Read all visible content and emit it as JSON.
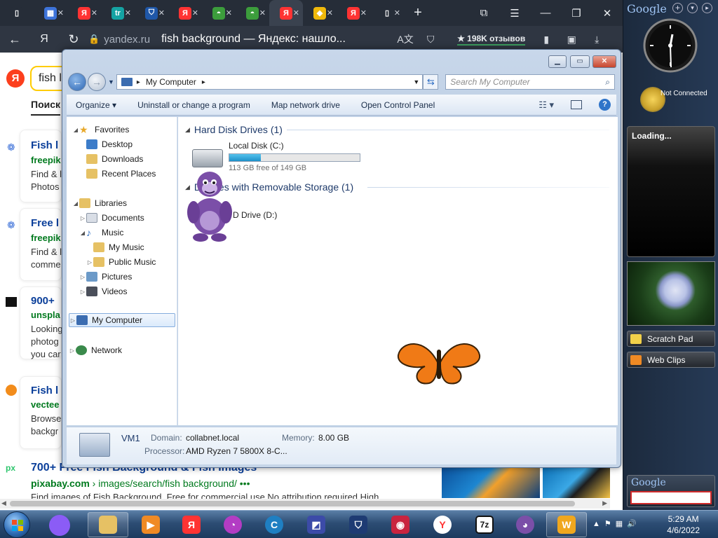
{
  "browser": {
    "tabs": [
      {
        "name": "tab-doc",
        "glyph": "▯",
        "color": "#262d38"
      },
      {
        "name": "tab-apps",
        "glyph": "▦",
        "color": "#3d73d9"
      },
      {
        "name": "tab-yandex-1",
        "glyph": "Я",
        "color": "#f33"
      },
      {
        "name": "tab-tr",
        "glyph": "tr",
        "color": "#15a3a3"
      },
      {
        "name": "tab-shield",
        "glyph": "⛉",
        "color": "#1f57a8"
      },
      {
        "name": "tab-yandex-2",
        "glyph": "Я",
        "color": "#f33"
      },
      {
        "name": "tab-melon-1",
        "glyph": "◓",
        "color": "#3c9d3c"
      },
      {
        "name": "tab-melon-2",
        "glyph": "◓",
        "color": "#3c9d3c"
      },
      {
        "name": "tab-yandex-active",
        "glyph": "Я",
        "color": "#f33"
      },
      {
        "name": "tab-binance",
        "glyph": "◆",
        "color": "#f0b90b"
      },
      {
        "name": "tab-yandex-3",
        "glyph": "Я",
        "color": "#f33"
      },
      {
        "name": "tab-doc-2",
        "glyph": "▯",
        "color": "#262d38"
      }
    ],
    "domain": "yandex.ru",
    "page_title": "fish background — Яндекс: нашло...",
    "reviews": "★ 198K отзывов"
  },
  "yandex": {
    "logo": "Я",
    "query": "fish l",
    "search_tab": "Поиск",
    "results": [
      {
        "title": "Fish l",
        "source": "freepik",
        "snippet": "Find & l\nPhotos"
      },
      {
        "title": "Free l",
        "source": "freepik",
        "snippet": "Find & l\ncomme"
      },
      {
        "title": "900+",
        "source": "unspla",
        "snippet": "Looking\nphotog\nyou car"
      },
      {
        "title": "Fish l",
        "source": "vectee",
        "snippet": "Browse\nbackgr"
      },
      {
        "title": "700+ Free Fish Background & Fish Images",
        "source": "pixabay.com",
        "path": " › images/search/fish background/  •••",
        "snippet": "Find images of Fish Background. Free for commercial use No attribution required High"
      }
    ]
  },
  "explorer": {
    "window_buttons": {
      "minimize": "▁",
      "maximize": "▭",
      "close": "✕"
    },
    "address_root": "▸",
    "address_path": "My Computer",
    "address_arrow": "▸",
    "search_placeholder": "Search My Computer",
    "commands": [
      "Organize ▾",
      "Uninstall or change a program",
      "Map network drive",
      "Open Control Panel"
    ],
    "nav": {
      "favorites": "Favorites",
      "desktop": "Desktop",
      "downloads": "Downloads",
      "recent": "Recent Places",
      "libraries": "Libraries",
      "documents": "Documents",
      "music": "Music",
      "my_music": "My Music",
      "public_music": "Public Music",
      "pictures": "Pictures",
      "videos": "Videos",
      "my_computer": "My Computer",
      "network": "Network"
    },
    "groups": {
      "hdd": "Hard Disk Drives (1)",
      "removable": "Devices with Removable Storage (1)"
    },
    "disk": {
      "name": "Local Disk (C:)",
      "free": "113 GB free of 149 GB",
      "used_fraction": 0.24
    },
    "dvd": {
      "name": "D Drive (D:)"
    },
    "details": {
      "name": "VM1",
      "domain_label": "Domain:",
      "domain": "collabnet.local",
      "memory_label": "Memory:",
      "memory": "8.00 GB",
      "processor_label": "Processor:",
      "processor": "AMD Ryzen 7 5800X 8-C..."
    }
  },
  "sidebar": {
    "google": "Google",
    "status": "Not Connected",
    "loading": "Loading...",
    "scratch": "Scratch Pad",
    "webclips": "Web Clips",
    "google_search": "Google"
  },
  "taskbar": {
    "time": "5:29 AM",
    "date": "4/6/2022"
  }
}
